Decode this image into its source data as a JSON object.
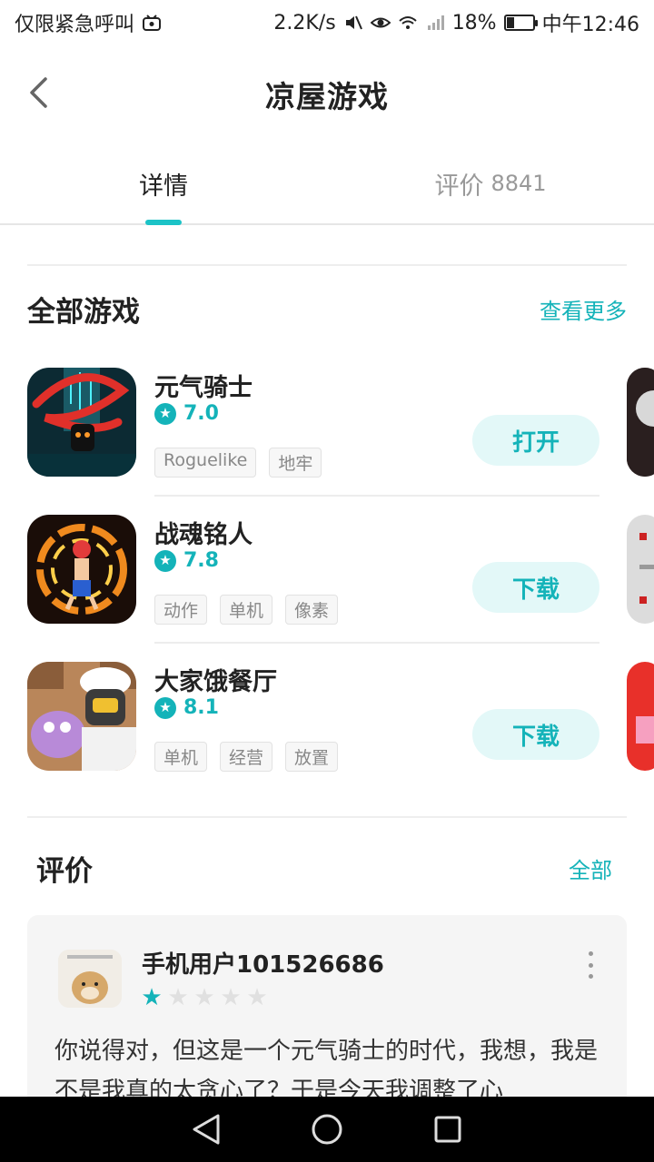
{
  "status_bar": {
    "carrier": "仅限紧急呼叫",
    "speed": "2.2K/s",
    "battery": "18%",
    "time": "中午12:46"
  },
  "header": {
    "title": "凉屋游戏"
  },
  "tabs": [
    {
      "label": "详情",
      "count": ""
    },
    {
      "label": "评价",
      "count": "8841"
    }
  ],
  "games_section": {
    "title": "全部游戏",
    "more_label": "查看更多",
    "items": [
      {
        "name": "元气骑士",
        "rating": "7.0",
        "tags": [
          "Roguelike",
          "地牢"
        ],
        "action": "打开"
      },
      {
        "name": "战魂铭人",
        "rating": "7.8",
        "tags": [
          "动作",
          "单机",
          "像素"
        ],
        "action": "下载"
      },
      {
        "name": "大家饿餐厅",
        "rating": "8.1",
        "tags": [
          "单机",
          "经营",
          "放置"
        ],
        "action": "下载"
      }
    ]
  },
  "reviews_section": {
    "title": "评价",
    "all_label": "全部",
    "review": {
      "user": "手机用户101526686",
      "stars": 1,
      "text": "你说得对，但这是一个元气骑士的时代，我想，我是不是我真的太贪心了？于是今天我调整了心"
    }
  },
  "colors": {
    "accent": "#14b3b9",
    "indicator": "#1cc3c7",
    "button_bg": "#e3f8f8",
    "card_bg": "#f5f5f5"
  },
  "icons": {
    "back": "chevron-left-icon",
    "star": "star-icon",
    "more": "more-vertical-icon",
    "nav_back": "triangle-back-icon",
    "nav_home": "circle-home-icon",
    "nav_recent": "square-recent-icon"
  }
}
